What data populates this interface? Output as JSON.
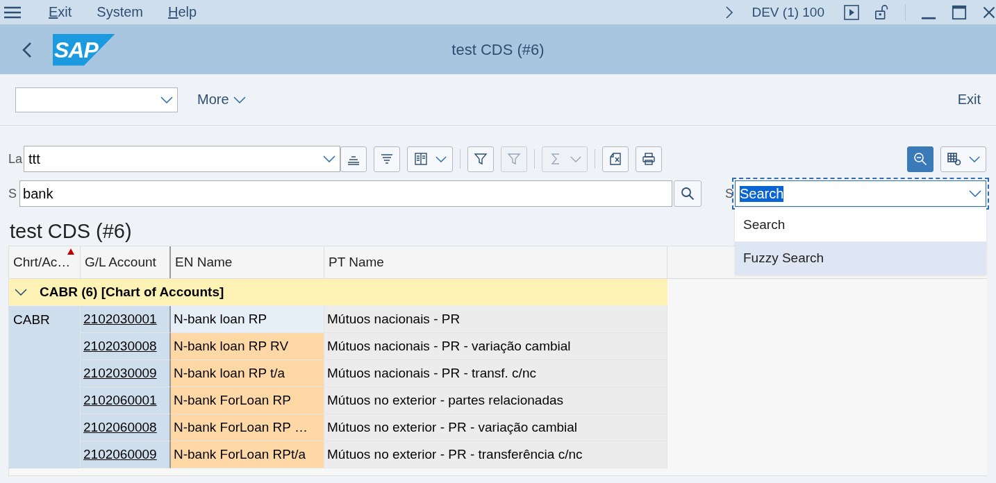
{
  "menu_bar": {
    "items": [
      {
        "label": "Exit",
        "mnemonic": true
      },
      {
        "label": "System",
        "mnemonic": false
      },
      {
        "label": "Help",
        "mnemonic": true
      }
    ],
    "system": "DEV (1) 100"
  },
  "header": {
    "logo": "SAP",
    "title": "test CDS (#6)"
  },
  "app_toolbar": {
    "more": "More",
    "exit": "Exit"
  },
  "alv_toolbar": {
    "layout_label": "La",
    "layout_value": "ttt",
    "buttons": [
      {
        "kind": "sort-asc",
        "disabled": false,
        "menu": false
      },
      {
        "kind": "sort-desc",
        "disabled": false,
        "menu": false
      },
      {
        "kind": "columns",
        "disabled": false,
        "menu": true
      },
      {
        "kind": "filter",
        "disabled": false,
        "menu": false
      },
      {
        "kind": "filter-delete",
        "disabled": true,
        "menu": false
      },
      {
        "kind": "sum",
        "disabled": true,
        "menu": true
      },
      {
        "kind": "export",
        "disabled": false,
        "menu": false
      },
      {
        "kind": "print",
        "disabled": false,
        "menu": false
      }
    ],
    "right_buttons": [
      {
        "kind": "zoom-out",
        "pressed": true,
        "menu": false
      },
      {
        "kind": "settings",
        "pressed": false,
        "menu": true
      }
    ]
  },
  "search": {
    "label": "S",
    "value": "bank",
    "mode_label": "S",
    "mode_value": "Search",
    "options": [
      {
        "label": "Search",
        "selected": false
      },
      {
        "label": "Fuzzy Search",
        "selected": true
      }
    ]
  },
  "table": {
    "title": "test CDS (#6)",
    "columns": [
      {
        "label": "Chrt/Ac…",
        "sorted": true
      },
      {
        "label": "G/L Account",
        "sorted": false
      },
      {
        "label": "EN Name",
        "sorted": false
      },
      {
        "label": "PT Name",
        "sorted": false
      }
    ],
    "group": {
      "label": "CABR (6) [Chart of Accounts]",
      "expanded": true
    },
    "rows": [
      {
        "chart": "CABR",
        "account": "2102030001",
        "en": "N-bank loan RP",
        "pt": "Mútuos nacionais - PR",
        "highlighted": false
      },
      {
        "account": "2102030008",
        "en": "N-bank loan RP RV",
        "pt": "Mútuos nacionais - PR - variação cambial",
        "highlighted": true
      },
      {
        "account": "2102030009",
        "en": "N-bank loan RP t/a",
        "pt": "Mútuos nacionais - PR - transf. c/nc",
        "highlighted": true
      },
      {
        "account": "2102060001",
        "en": "N-bank ForLoan RP",
        "pt": "Mútuos no exterior - partes relacionadas",
        "highlighted": true
      },
      {
        "account": "2102060008",
        "en": "N-bank ForLoan RP …",
        "pt": "Mútuos no exterior - PR - variação cambial",
        "highlighted": true
      },
      {
        "account": "2102060009",
        "en": "N-bank ForLoan RPt/a",
        "pt": "Mútuos no exterior - PR - transferência c/nc",
        "highlighted": true
      }
    ]
  }
}
